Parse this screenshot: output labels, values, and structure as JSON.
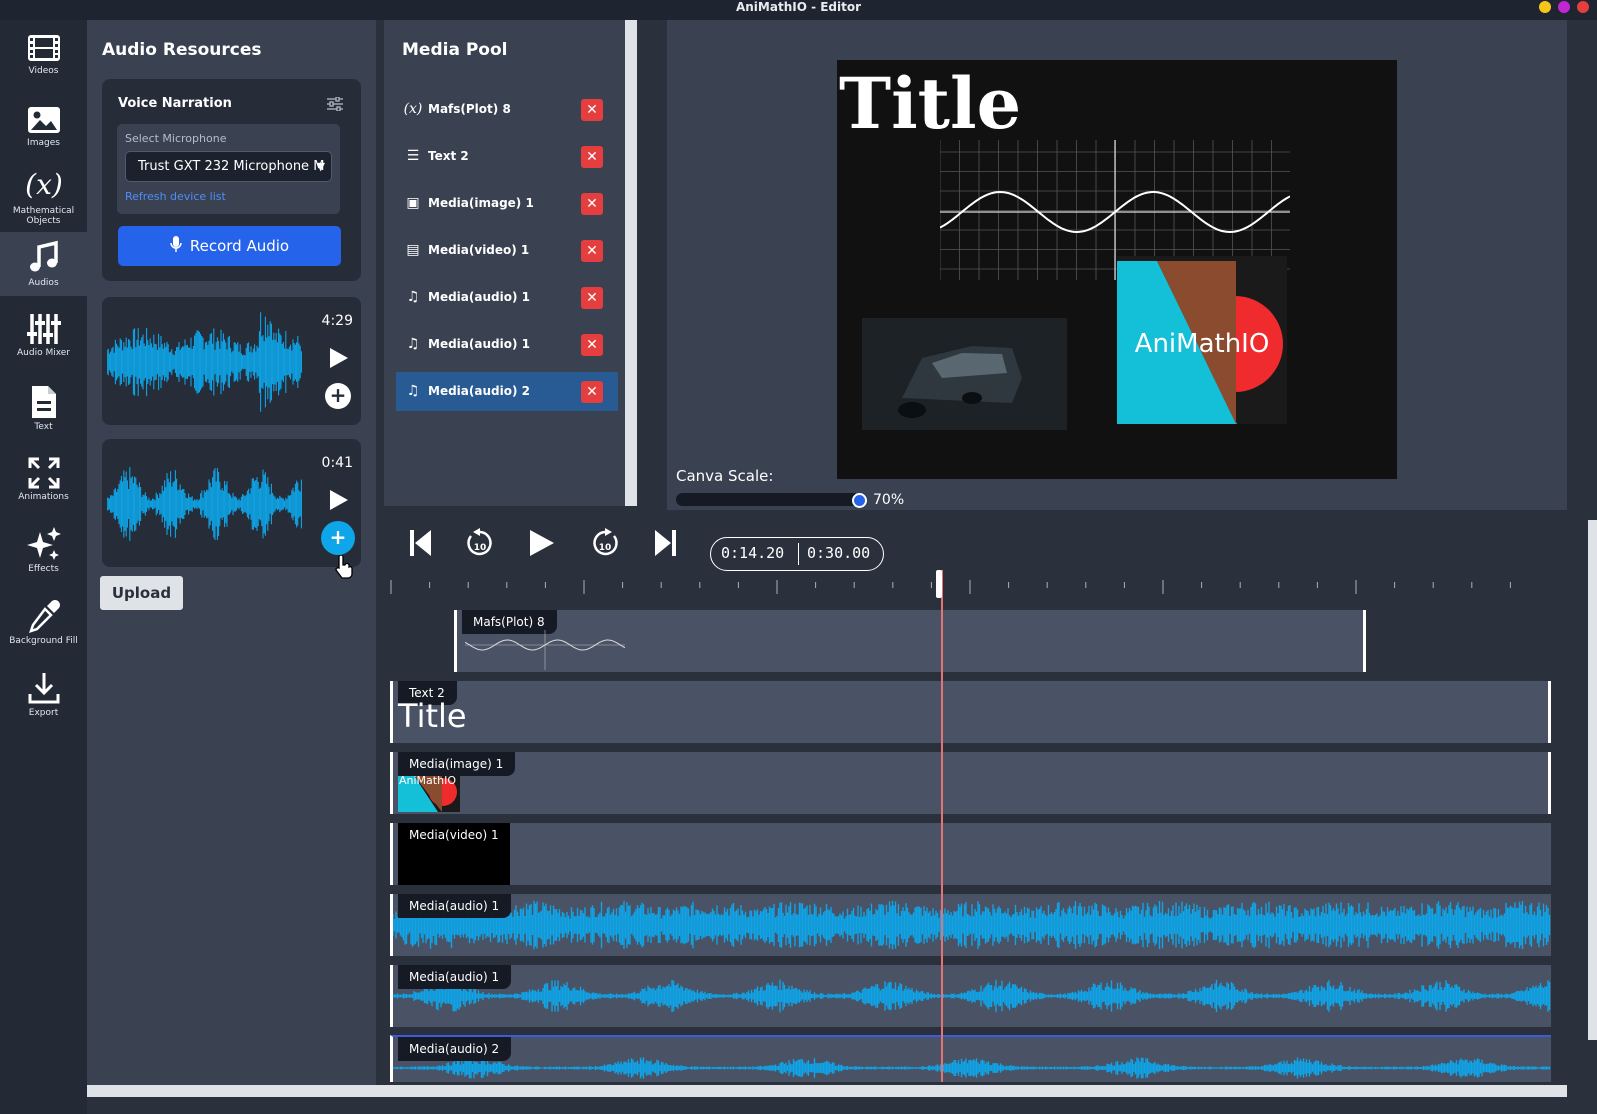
{
  "window": {
    "title": "AniMathIO - Editor"
  },
  "sidebar": {
    "items": [
      {
        "label": "Videos",
        "icon": "film-icon"
      },
      {
        "label": "Images",
        "icon": "image-icon"
      },
      {
        "label": "Mathematical Objects",
        "icon": "function-icon"
      },
      {
        "label": "Audios",
        "icon": "music-note-icon",
        "active": true
      },
      {
        "label": "Audio Mixer",
        "icon": "mixer-sliders-icon"
      },
      {
        "label": "Text",
        "icon": "document-icon"
      },
      {
        "label": "Animations",
        "icon": "expand-arrows-icon"
      },
      {
        "label": "Effects",
        "icon": "sparkles-icon"
      },
      {
        "label": "Background Fill",
        "icon": "eyedropper-icon"
      },
      {
        "label": "Export",
        "icon": "download-icon"
      }
    ]
  },
  "audio_panel": {
    "title": "Audio Resources",
    "voice": {
      "header": "Voice Narration",
      "mic_label": "Select Microphone",
      "mic_value": "Trust GXT 232 Microphone M",
      "refresh": "Refresh device list",
      "record": "Record Audio"
    },
    "clips": [
      {
        "duration": "4:29"
      },
      {
        "duration": "0:41"
      }
    ],
    "upload": "Upload"
  },
  "media_pool": {
    "title": "Media Pool",
    "items": [
      {
        "name": "Mafs(Plot) 8",
        "icon": "function-icon",
        "glyph": "(x)"
      },
      {
        "name": "Text 2",
        "icon": "text-lines-icon",
        "glyph": "☰"
      },
      {
        "name": "Media(image) 1",
        "icon": "image-icon",
        "glyph": "▣"
      },
      {
        "name": "Media(video) 1",
        "icon": "film-icon",
        "glyph": "▤"
      },
      {
        "name": "Media(audio) 1",
        "icon": "music-note-icon",
        "glyph": "♫"
      },
      {
        "name": "Media(audio) 1",
        "icon": "music-note-icon",
        "glyph": "♫"
      },
      {
        "name": "Media(audio) 2",
        "icon": "music-note-icon",
        "glyph": "♫",
        "selected": true
      }
    ],
    "delete_glyph": "✕"
  },
  "preview": {
    "canvas_title": "Title",
    "logo_text": "AniMathIO",
    "scale_label": "Canva Scale:",
    "scale_value": "70%",
    "scale_fraction": 0.7
  },
  "timeline": {
    "current_time": "0:14.20",
    "total_time": "0:30.00",
    "tracks": [
      {
        "label": "Mafs(Plot) 8"
      },
      {
        "label": "Text 2",
        "preview": "Title"
      },
      {
        "label": "Media(image) 1",
        "preview": "AniMathIO"
      },
      {
        "label": "Media(video) 1"
      },
      {
        "label": "Media(audio) 1"
      },
      {
        "label": "Media(audio) 1"
      },
      {
        "label": "Media(audio) 2"
      }
    ]
  },
  "colors": {
    "accent": "#2563eb",
    "waveform": "#0ea5e9",
    "delete": "#e53e3e",
    "selected": "#285a93",
    "playhead": "#e57373"
  }
}
